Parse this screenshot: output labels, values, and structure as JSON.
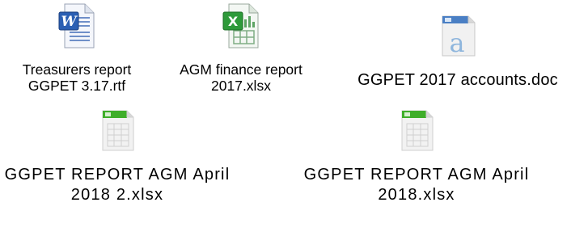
{
  "desktop": {
    "files": [
      {
        "icon": "word-document-icon",
        "name_line1": "Treasurers report",
        "name_line2": "GGPET 3.17.rtf"
      },
      {
        "icon": "excel-spreadsheet-icon",
        "name_line1": "AGM finance report",
        "name_line2": "2017.xlsx"
      },
      {
        "icon": "generic-document-icon",
        "name_line1": "GGPET 2017 accounts.doc"
      },
      {
        "icon": "spreadsheet-icon",
        "name_line1": "GGPET REPORT AGM April",
        "name_line2": "2018 2.xlsx"
      },
      {
        "icon": "spreadsheet-icon",
        "name_line1": "GGPET REPORT AGM April",
        "name_line2": "2018.xlsx"
      }
    ]
  },
  "colors": {
    "word_blue": "#2b5fb3",
    "excel_green": "#2e9a3a",
    "sheet_header_green": "#3fae2a",
    "doc_letter_blue": "#8fb6dd"
  }
}
